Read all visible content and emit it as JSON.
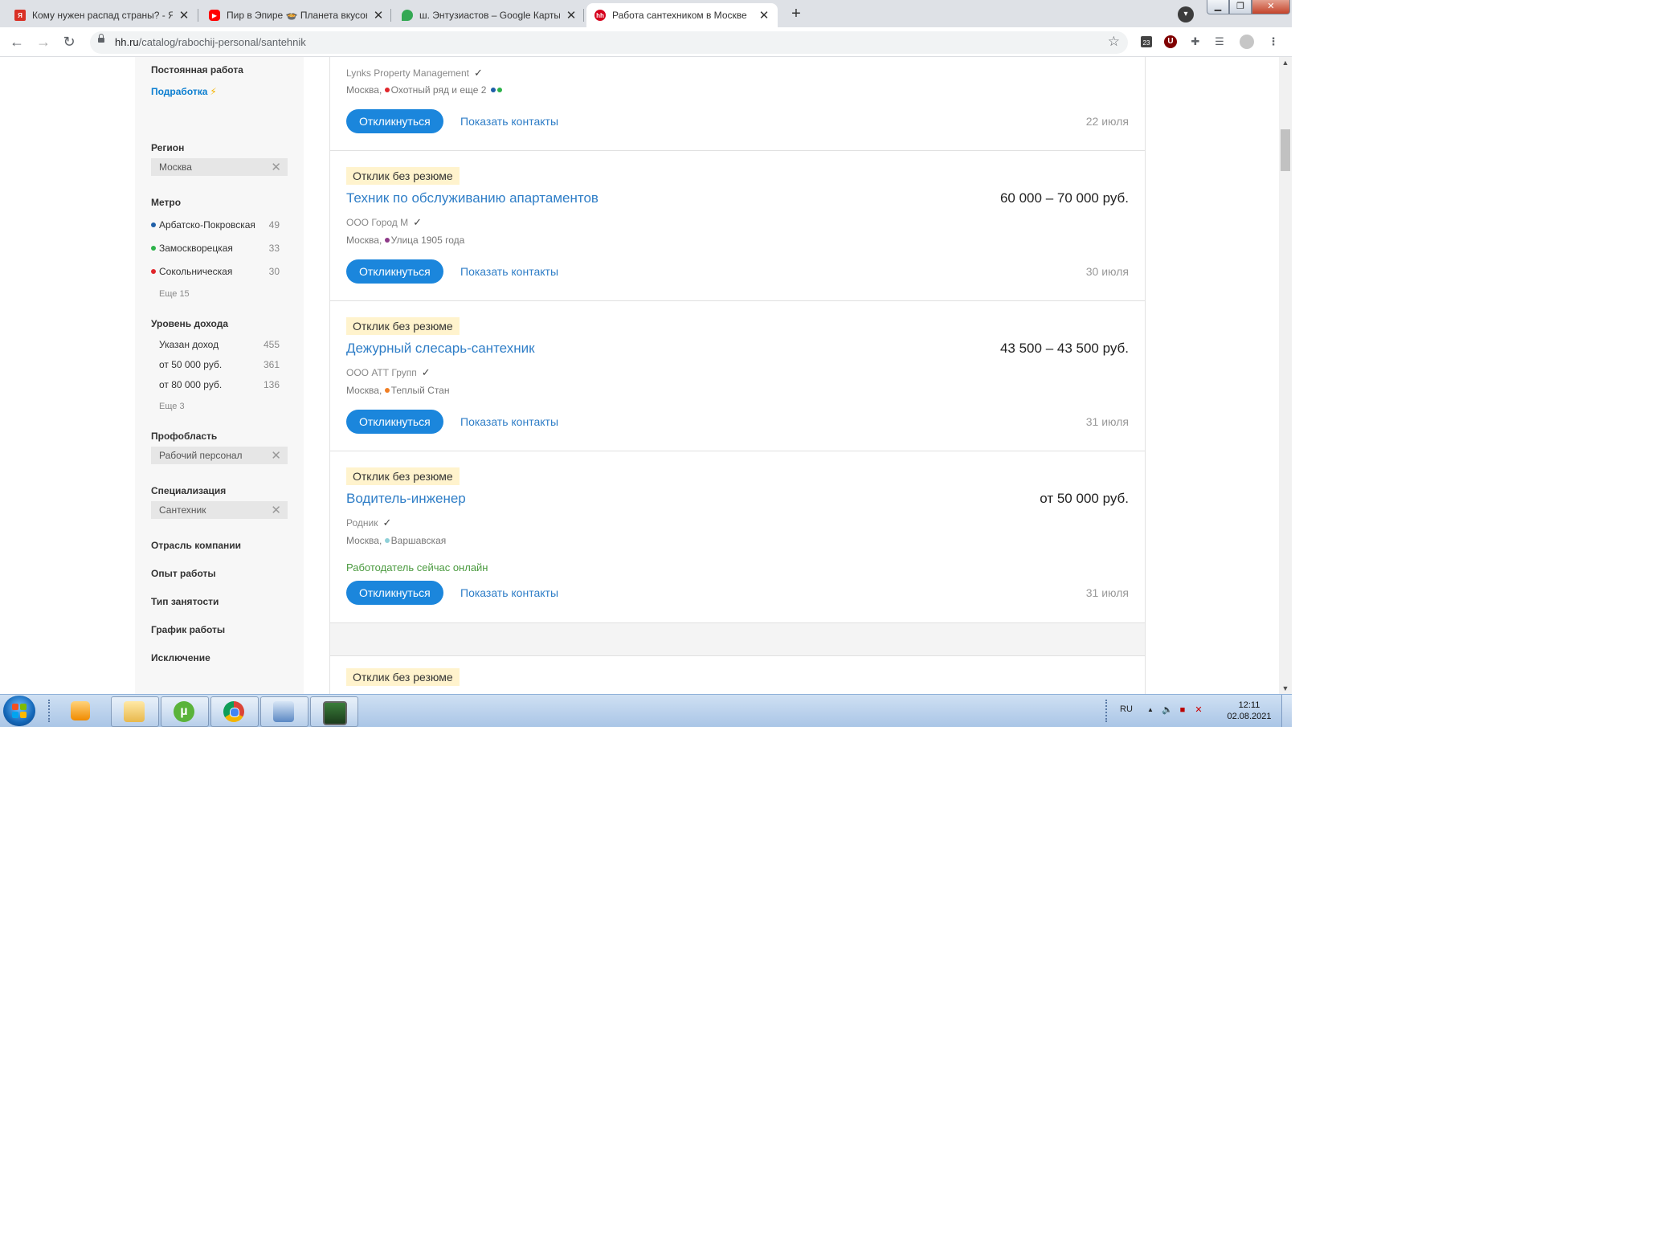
{
  "browser": {
    "tabs": [
      {
        "title": "Кому нужен распад страны? - Я",
        "favicon": "yandex-zen-icon",
        "color": "#d93025",
        "active": false
      },
      {
        "title": "Пир в Эпире 🍲 Планета вкусов",
        "favicon": "youtube-icon",
        "color": "#ff0000",
        "active": false
      },
      {
        "title": "ш. Энтузиастов – Google Карты",
        "favicon": "google-maps-icon",
        "color": "#34a853",
        "active": false
      },
      {
        "title": "Работа сантехником в Москве",
        "favicon": "hh-icon",
        "color": "#d6001c",
        "active": true
      }
    ],
    "new_tab": "+",
    "url_host": "hh.ru",
    "url_path": "/catalog/rabochij-personal/santehnik",
    "ext_badge": "23"
  },
  "sidebar": {
    "employment_permanent": "Постоянная работа",
    "employment_part": "Подработка",
    "region_title": "Регион",
    "region_value": "Москва",
    "metro_title": "Метро",
    "metro": [
      {
        "name": "Арбатско-Покровская",
        "count": "49",
        "color": "#1f5fa8"
      },
      {
        "name": "Замоскворецкая",
        "count": "33",
        "color": "#2db24a"
      },
      {
        "name": "Сокольническая",
        "count": "30",
        "color": "#e0262b"
      }
    ],
    "metro_more": "Еще 15",
    "income_title": "Уровень дохода",
    "income": [
      {
        "name": "Указан доход",
        "count": "455"
      },
      {
        "name": "от 50 000 руб.",
        "count": "361"
      },
      {
        "name": "от 80 000 руб.",
        "count": "136"
      }
    ],
    "income_more": "Еще 3",
    "prof_title": "Профобласть",
    "prof_value": "Рабочий персонал",
    "spec_title": "Специализация",
    "spec_value": "Сантехник",
    "links": [
      "Отрасль компании",
      "Опыт работы",
      "Тип занятости",
      "График работы",
      "Исключение"
    ]
  },
  "vacancies": [
    {
      "badge": "",
      "title": "",
      "salary": "",
      "company": "Lynks Property Management",
      "city": "Москва,",
      "metro": "Охотный ряд и еще 2",
      "metro_color": "#e0262b",
      "online": "",
      "respond": "Откликнуться",
      "contacts": "Показать контакты",
      "date": "22 июля"
    },
    {
      "badge": "Отклик без резюме",
      "title": "Техник по обслуживанию апартаментов",
      "salary": "60 000 – 70 000 руб.",
      "company": "ООО Город М",
      "city": "Москва,",
      "metro": "Улица 1905 года",
      "metro_color": "#8e3a88",
      "online": "",
      "respond": "Откликнуться",
      "contacts": "Показать контакты",
      "date": "30 июля"
    },
    {
      "badge": "Отклик без резюме",
      "title": "Дежурный слесарь-сантехник",
      "salary": "43 500 – 43 500 руб.",
      "company": "ООО АТТ Групп",
      "city": "Москва,",
      "metro": "Теплый Стан",
      "metro_color": "#f07e24",
      "online": "",
      "respond": "Откликнуться",
      "contacts": "Показать контакты",
      "date": "31 июля"
    },
    {
      "badge": "Отклик без резюме",
      "title": "Водитель-инженер",
      "salary": "от 50 000 руб.",
      "company": "Родник",
      "city": "Москва,",
      "metro": "Варшавская",
      "metro_color": "#8fd0d8",
      "online": "Работодатель сейчас онлайн",
      "respond": "Откликнуться",
      "contacts": "Показать контакты",
      "date": "31 июля"
    },
    {
      "badge": "Отклик без резюме"
    }
  ],
  "taskbar": {
    "lang": "RU",
    "time": "12:11",
    "date": "02.08.2021"
  }
}
